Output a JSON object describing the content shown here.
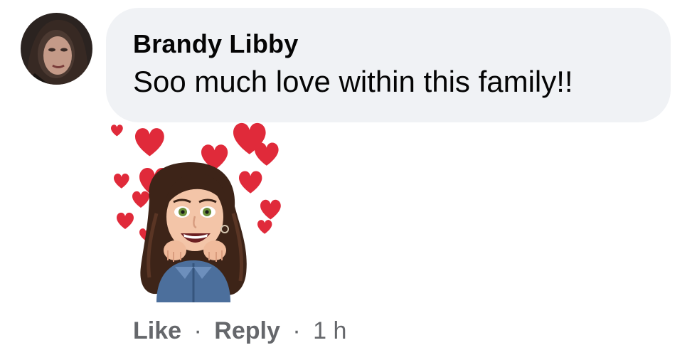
{
  "comment": {
    "author": "Brandy Libby",
    "text": "Soo much love within this family!!",
    "actions": {
      "like_label": "Like",
      "separator": "·",
      "reply_label": "Reply",
      "time": "1 h"
    }
  },
  "avatar": {
    "icon": "profile-photo"
  },
  "sticker": {
    "icon": "avatar-hearts-sticker"
  },
  "colors": {
    "bubble_bg": "#f0f2f5",
    "text_primary": "#050505",
    "text_secondary": "#65676b",
    "heart": "#e02a3a"
  }
}
